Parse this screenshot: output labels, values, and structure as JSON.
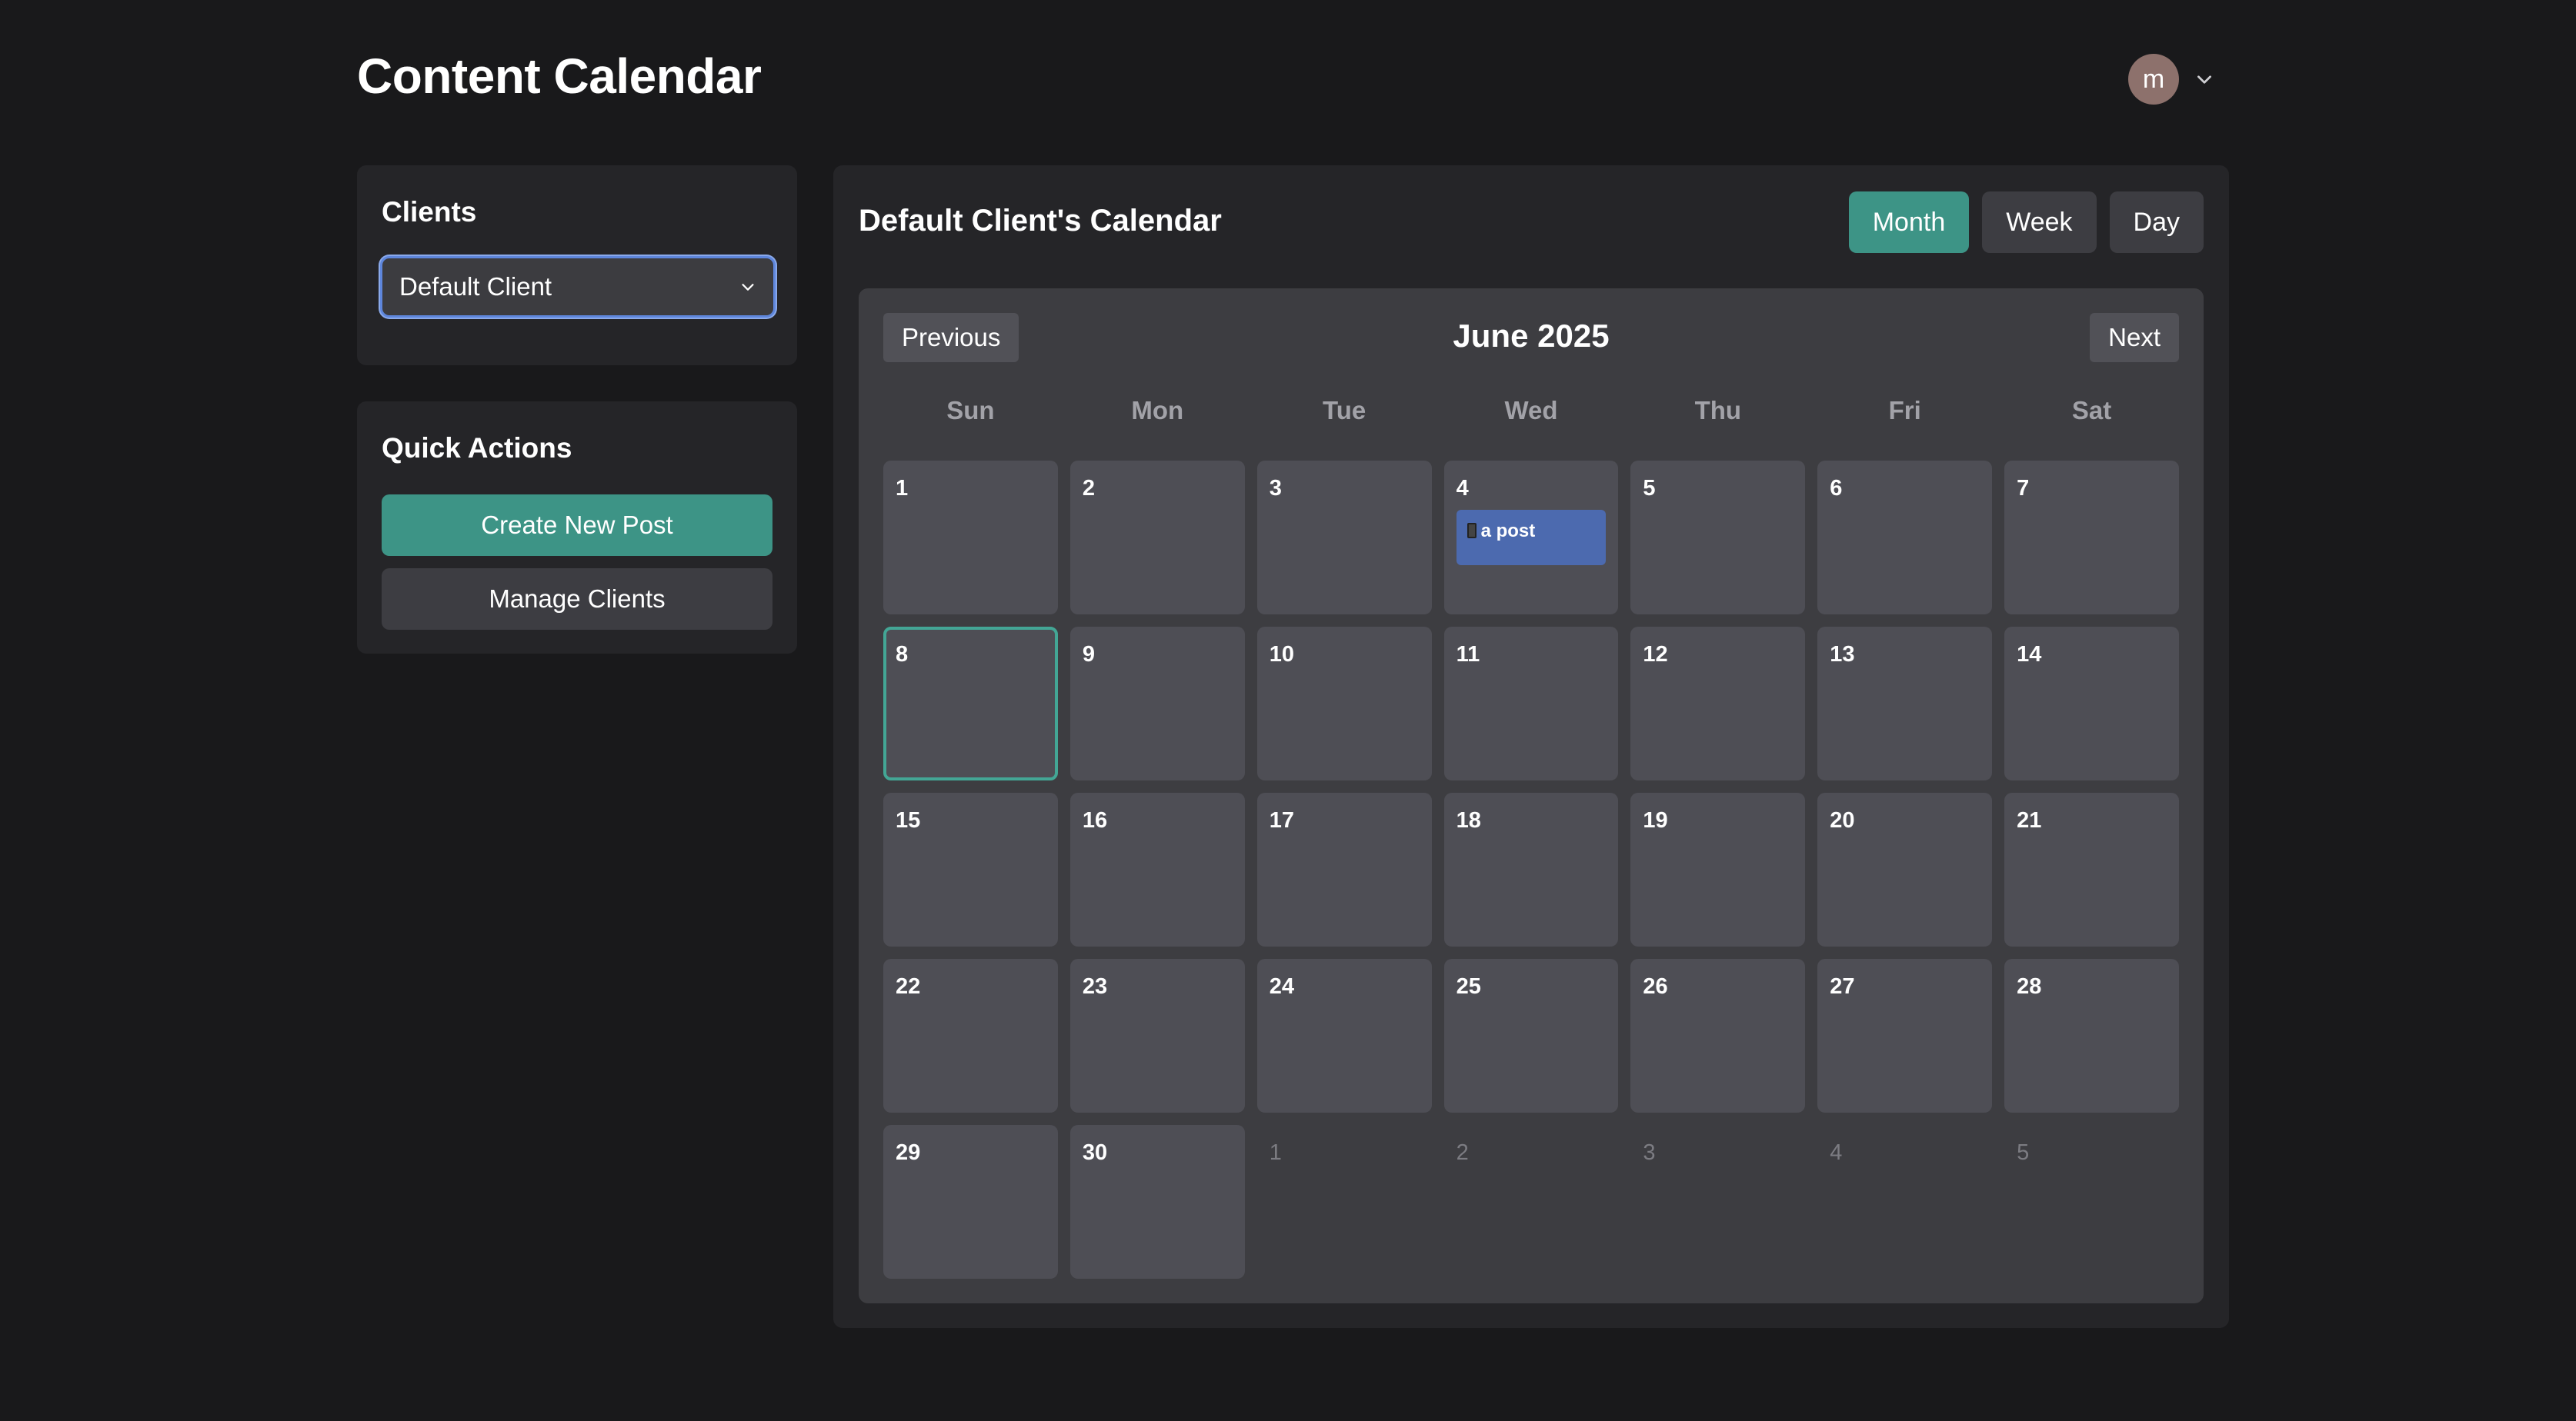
{
  "header": {
    "title": "Content Calendar",
    "avatar_initial": "m"
  },
  "clients_panel": {
    "title": "Clients",
    "selected": "Default Client"
  },
  "quick_actions": {
    "title": "Quick Actions",
    "create_label": "Create New Post",
    "manage_label": "Manage Clients"
  },
  "calendar": {
    "title": "Default Client's Calendar",
    "views": [
      "Month",
      "Week",
      "Day"
    ],
    "active_view": "Month",
    "prev_label": "Previous",
    "next_label": "Next",
    "month_label": "June 2025",
    "weekdays": [
      "Sun",
      "Mon",
      "Tue",
      "Wed",
      "Thu",
      "Fri",
      "Sat"
    ],
    "days": [
      {
        "n": "1"
      },
      {
        "n": "2"
      },
      {
        "n": "3"
      },
      {
        "n": "4",
        "event": "a post"
      },
      {
        "n": "5"
      },
      {
        "n": "6"
      },
      {
        "n": "7"
      },
      {
        "n": "8",
        "today": true
      },
      {
        "n": "9"
      },
      {
        "n": "10"
      },
      {
        "n": "11"
      },
      {
        "n": "12"
      },
      {
        "n": "13"
      },
      {
        "n": "14"
      },
      {
        "n": "15"
      },
      {
        "n": "16"
      },
      {
        "n": "17"
      },
      {
        "n": "18"
      },
      {
        "n": "19"
      },
      {
        "n": "20"
      },
      {
        "n": "21"
      },
      {
        "n": "22"
      },
      {
        "n": "23"
      },
      {
        "n": "24"
      },
      {
        "n": "25"
      },
      {
        "n": "26"
      },
      {
        "n": "27"
      },
      {
        "n": "28"
      },
      {
        "n": "29"
      },
      {
        "n": "30"
      },
      {
        "n": "1",
        "other": true
      },
      {
        "n": "2",
        "other": true
      },
      {
        "n": "3",
        "other": true
      },
      {
        "n": "4",
        "other": true
      },
      {
        "n": "5",
        "other": true
      }
    ]
  },
  "colors": {
    "accent": "#3d9486",
    "event": "#4c6aaf",
    "focus": "#5e86dc"
  }
}
